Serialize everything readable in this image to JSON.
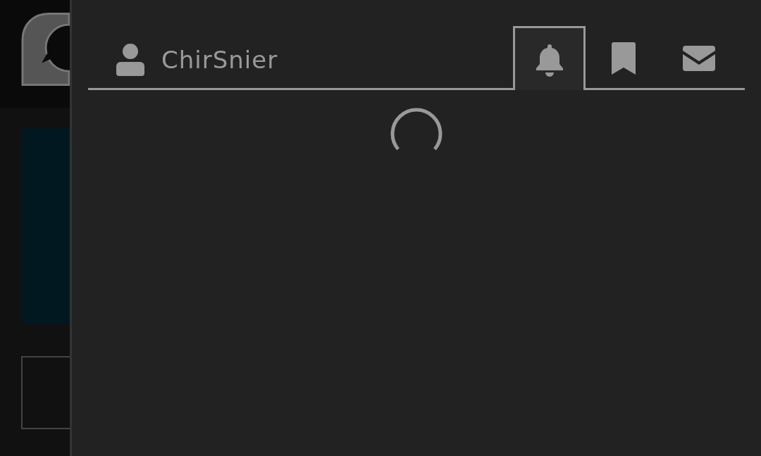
{
  "panel": {
    "user": {
      "name": "ChirSnier"
    },
    "tabs": [
      {
        "kind": "notifications",
        "selected": true
      },
      {
        "kind": "bookmarks",
        "selected": false
      },
      {
        "kind": "messages",
        "selected": false
      }
    ],
    "content": {
      "loading": true
    }
  }
}
